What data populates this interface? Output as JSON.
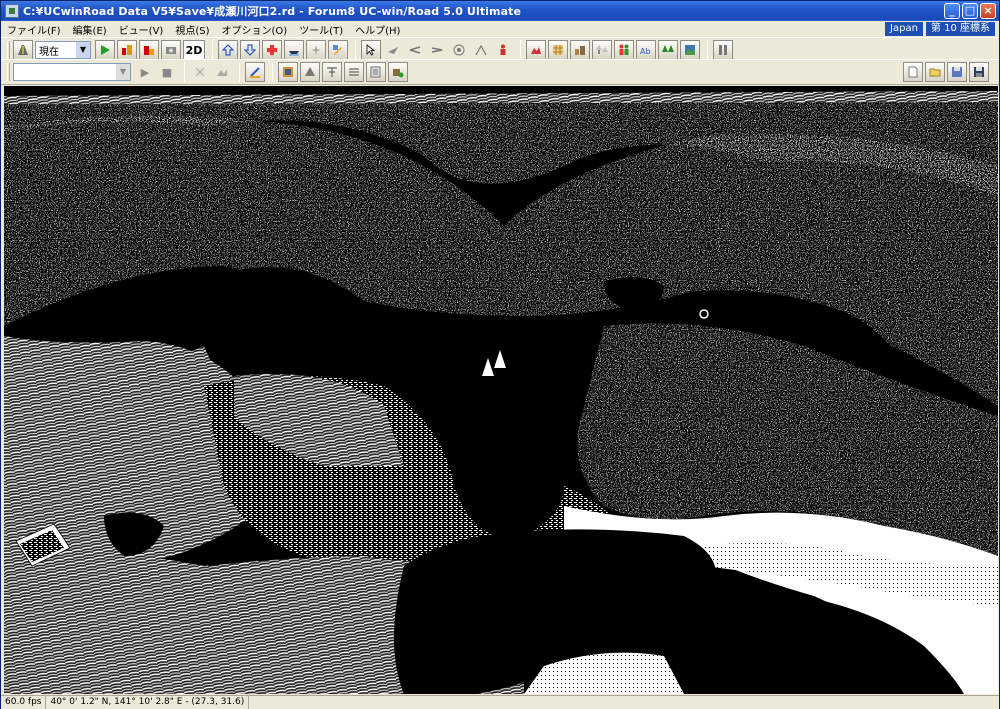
{
  "window": {
    "title": "C:¥UCwinRoad Data V5¥Save¥成瀬川河口2.rd - Forum8 UC-win/Road 5.0 Ultimate",
    "buttons": {
      "minimize": "_",
      "maximize": "□",
      "close": "×"
    }
  },
  "menu": {
    "items": [
      "ファイル(F)",
      "編集(E)",
      "ビュー(V)",
      "視点(S)",
      "オプション(O)",
      "ツール(T)",
      "ヘルプ(H)"
    ],
    "region": "Japan",
    "coordinate_system": "第 10 座標系"
  },
  "toolbar": {
    "viewpoint_select": "現在",
    "btn_2d": "2D",
    "play_label": "▶",
    "stop_label": "■"
  },
  "icons": {
    "tb1": [
      "road-icon",
      "play-green-icon",
      "traffic-icon",
      "traffic-alt-icon",
      "camera-icon",
      "move-up-icon",
      "move-down-icon",
      "cross-icon",
      "boat-icon",
      "compass-icon",
      "edit-model-icon",
      "pointer-icon",
      "fly-icon",
      "drive-icon",
      "walk-icon",
      "target-icon",
      "measure-icon",
      "person-icon",
      "terrain-icon",
      "grid-icon",
      "buildings-icon",
      "trees-icon",
      "people-icon",
      "text-icon",
      "forest-icon",
      "image-icon",
      "cluster-icon"
    ],
    "tb2": [
      "zoom-icon",
      "image-small-icon",
      "ruler-icon",
      "mesh-icon",
      "cone-icon",
      "cut-icon",
      "section-icon",
      "edit-icon",
      "add-object-icon",
      "new-file-icon",
      "open-folder-icon",
      "save-as-icon",
      "save-icon"
    ]
  },
  "status": {
    "fps": "60.0 fps",
    "coordinates": "40° 0' 1.2\" N, 141° 10' 2.8\" E - (27.3, 31.6)"
  },
  "colors": {
    "titlebar": "#2155c8",
    "viewport_bg": "#000000",
    "terrain": "#ffffff"
  }
}
